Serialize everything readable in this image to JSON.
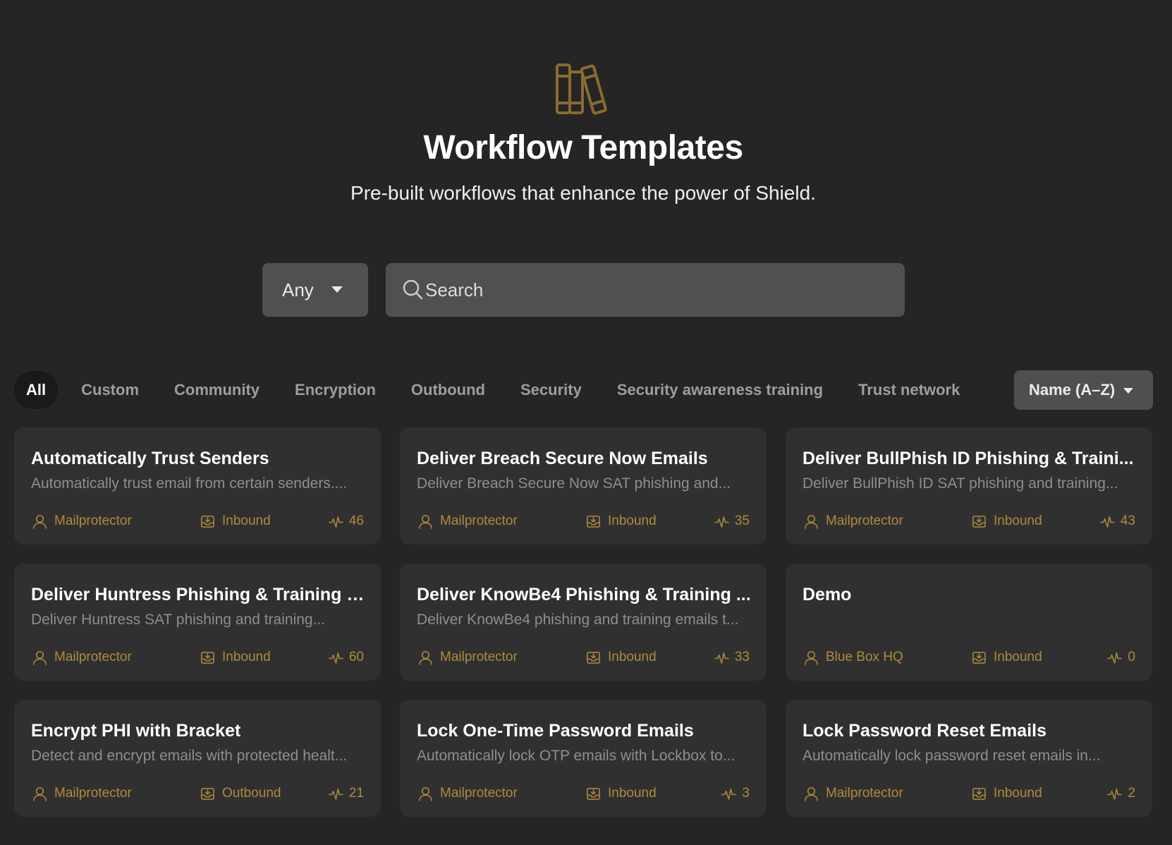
{
  "header": {
    "icon": "books-icon",
    "title": "Workflow Templates",
    "subtitle": "Pre-built workflows that enhance the power of Shield."
  },
  "filters": {
    "source_select": {
      "value": "Any",
      "icon": "caret-down-icon"
    },
    "search": {
      "placeholder": "Search",
      "value": "",
      "icon": "search-icon"
    }
  },
  "tabs": [
    {
      "label": "All",
      "active": true
    },
    {
      "label": "Custom",
      "active": false
    },
    {
      "label": "Community",
      "active": false
    },
    {
      "label": "Encryption",
      "active": false
    },
    {
      "label": "Outbound",
      "active": false
    },
    {
      "label": "Security",
      "active": false
    },
    {
      "label": "Security awareness training",
      "active": false
    },
    {
      "label": "Trust network",
      "active": false
    }
  ],
  "sort": {
    "value": "Name (A–Z)",
    "icon": "caret-down-icon"
  },
  "colors": {
    "background": "#252525",
    "card": "#303030",
    "accent": "#b08a3c",
    "muted_text": "#8e8e8e",
    "control": "#505050"
  },
  "cards": [
    {
      "title": "Automatically Trust Senders",
      "description": "Automatically trust email from certain senders....",
      "author": "Mailprotector",
      "direction": "Inbound",
      "runs": "46"
    },
    {
      "title": "Deliver Breach Secure Now Emails",
      "description": "Deliver Breach Secure Now SAT phishing and...",
      "author": "Mailprotector",
      "direction": "Inbound",
      "runs": "35"
    },
    {
      "title": "Deliver BullPhish ID Phishing & Traini...",
      "description": "Deliver BullPhish ID SAT phishing and training...",
      "author": "Mailprotector",
      "direction": "Inbound",
      "runs": "43"
    },
    {
      "title": "Deliver Huntress Phishing & Training E...",
      "description": "Deliver Huntress SAT phishing and training...",
      "author": "Mailprotector",
      "direction": "Inbound",
      "runs": "60"
    },
    {
      "title": "Deliver KnowBe4 Phishing & Training ...",
      "description": "Deliver KnowBe4 phishing and training emails t...",
      "author": "Mailprotector",
      "direction": "Inbound",
      "runs": "33"
    },
    {
      "title": "Demo",
      "description": "",
      "author": "Blue Box HQ",
      "direction": "Inbound",
      "runs": "0"
    },
    {
      "title": "Encrypt PHI with Bracket",
      "description": "Detect and encrypt emails with protected healt...",
      "author": "Mailprotector",
      "direction": "Outbound",
      "runs": "21"
    },
    {
      "title": "Lock One-Time Password Emails",
      "description": "Automatically lock OTP emails with Lockbox to...",
      "author": "Mailprotector",
      "direction": "Inbound",
      "runs": "3"
    },
    {
      "title": "Lock Password Reset Emails",
      "description": "Automatically lock password reset emails in...",
      "author": "Mailprotector",
      "direction": "Inbound",
      "runs": "2"
    }
  ]
}
